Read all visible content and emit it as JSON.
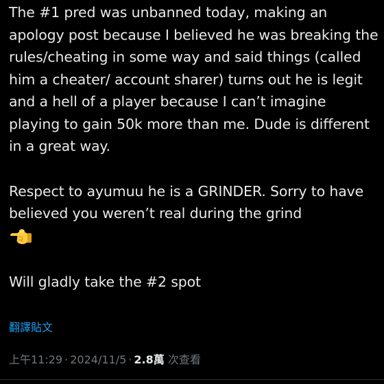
{
  "tweet": {
    "paragraphs": [
      "The #1 pred was unbanned today, making an apology post because I believed he was breaking the rules/cheating in some way and said things (called him a cheater/ account sharer) turns out he is legit and a hell of a player because I can’t imagine playing to gain 50k more than me. Dude is different in a great way.",
      "Respect to ayumuu he is a GRINDER. Sorry to have believed you weren’t real during the grind",
      "Will gladly take the #2 spot"
    ],
    "emoji": "backhand-index-pointing-left-emoji"
  },
  "translate_link": "翻譯貼文",
  "meta": {
    "time": "上午11:29",
    "separator": "·",
    "date": "2024/11/5",
    "views_count": "2.8萬",
    "views_label": "次查看"
  },
  "colors": {
    "background": "#000000",
    "text": "#e7e9ea",
    "secondary_text": "#71767b",
    "link": "#1d9bf0",
    "divider": "#2f3336"
  }
}
